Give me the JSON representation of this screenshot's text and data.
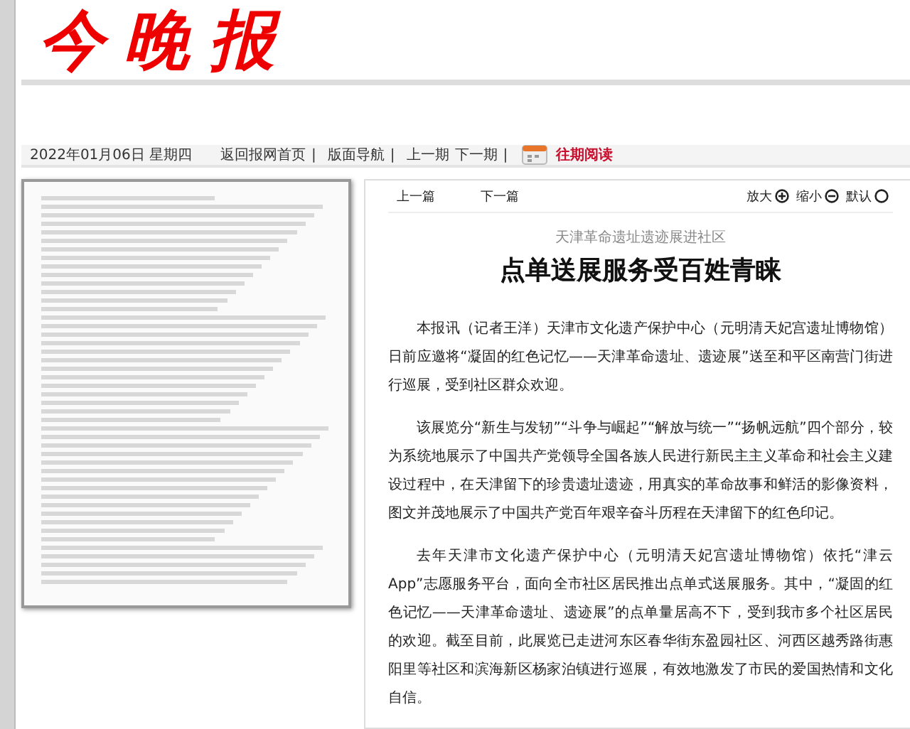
{
  "masthead": {
    "logo": "今晚报"
  },
  "nav_bar": {
    "date": "2022年01月06日 星期四",
    "links": [
      {
        "label": "返回报网首页",
        "separator": "|"
      },
      {
        "label": "版面导航",
        "separator": "|"
      },
      {
        "label": "上一期"
      },
      {
        "label": "下一期",
        "separator": "|"
      }
    ],
    "archive_link": "往期阅读"
  },
  "article_toolbar": {
    "prev": "上一篇",
    "next": "下一篇",
    "zoom": [
      {
        "label": "放大",
        "kind": "plus"
      },
      {
        "label": "缩小",
        "kind": "minus"
      },
      {
        "label": "默认",
        "kind": "reset"
      }
    ]
  },
  "article": {
    "subtitle": "天津革命遗址遗迹展进社区",
    "title": "点单送展服务受百姓青睐",
    "paragraphs": [
      "本报讯（记者王洋）天津市文化遗产保护中心（元明清天妃宫遗址博物馆）日前应邀将“凝固的红色记忆——天津革命遗址、遗迹展”送至和平区南营门街进行巡展，受到社区群众欢迎。",
      "该展览分“新生与发轫”“斗争与崛起”“解放与统一”“扬帆远航”四个部分，较为系统地展示了中国共产党领导全国各族人民进行新民主主义革命和社会主义建设过程中，在天津留下的珍贵遗址遗迹，用真实的革命故事和鲜活的影像资料，图文并茂地展示了中国共产党百年艰辛奋斗历程在天津留下的红色印记。",
      "去年天津市文化遗产保护中心（元明清天妃宫遗址博物馆）依托“津云App”志愿服务平台，面向全市社区居民推出点单式送展服务。其中，“凝固的红色记忆——天津革命遗址、遗迹展”的点单量居高不下，受到我市多个社区居民的欢迎。截至目前，此展览已走进河东区春华街东盈园社区、河西区越秀路街惠阳里等社区和滨海新区杨家泊镇进行巡展，有效地激发了市民的爱国热情和文化自信。"
    ]
  }
}
